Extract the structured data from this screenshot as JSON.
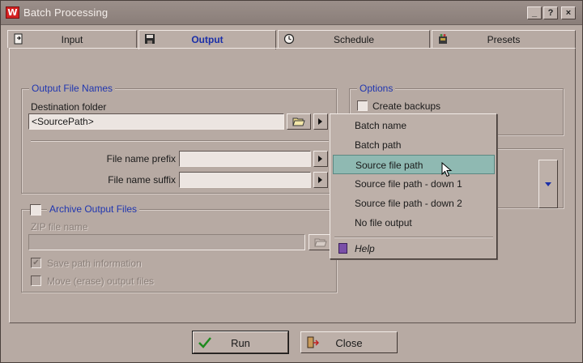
{
  "window": {
    "title": "Batch Processing",
    "logo_letter": "W",
    "help_button": "?",
    "minimize_button": "_",
    "close_button": "×"
  },
  "tabs": [
    {
      "label": "Input",
      "icon": "input-doc-icon",
      "active": false
    },
    {
      "label": "Output",
      "icon": "floppy-disk-icon",
      "active": true
    },
    {
      "label": "Schedule",
      "icon": "clock-icon",
      "active": false
    },
    {
      "label": "Presets",
      "icon": "presets-icon",
      "active": false
    }
  ],
  "output_names": {
    "group_title": "Output File Names",
    "destination_label": "Destination folder",
    "destination_value": "<SourcePath>",
    "prefix_label": "File name prefix",
    "prefix_value": "",
    "suffix_label": "File name suffix",
    "suffix_value": ""
  },
  "archive": {
    "title": "Archive Output Files",
    "zip_label": "ZIP file name",
    "zip_value": "",
    "save_path_label": "Save path information",
    "save_path_checked": true,
    "move_label": "Move (erase) output files",
    "move_checked": false
  },
  "options": {
    "group_title": "Options",
    "create_backups_label": "Create backups",
    "create_backups_checked": false
  },
  "menu": {
    "items": [
      "Batch name",
      "Batch path",
      "Source file path",
      "Source file path - down 1",
      "Source file path - down 2",
      "No file output"
    ],
    "highlighted_index": 2,
    "help_label": "Help"
  },
  "buttons": {
    "run": "Run",
    "close": "Close"
  },
  "colors": {
    "accent_text": "#1b2fa8",
    "menu_highlight": "#8fb9b2",
    "window_bg": "#b7aaa3"
  }
}
